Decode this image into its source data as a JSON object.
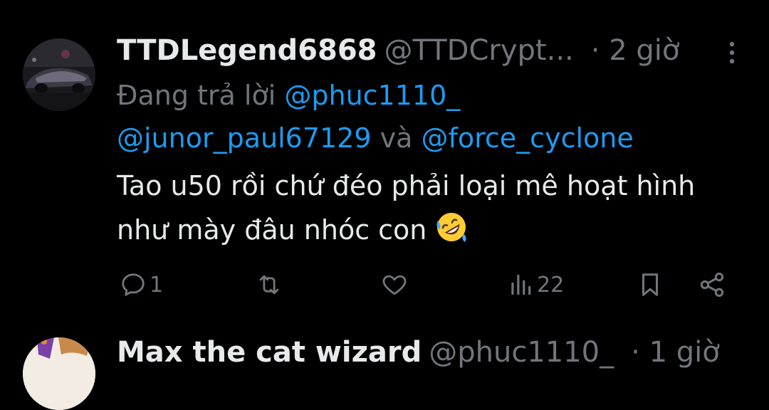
{
  "tweet": {
    "display_name": "TTDLegend6868",
    "handle": "@TTDCrypt...",
    "separator": "·",
    "time": "2 giờ",
    "avatar_icon": "profile-photo-car",
    "reply_prefix": "Đang trả lời",
    "reply_mentions": [
      "@phuc1110_",
      "@junor_paul67129",
      "@force_cyclone"
    ],
    "reply_conjunction": "và",
    "text": "Tao u50 rồi chứ đéo phải loại mê hoạt hình như mày đâu nhóc con",
    "emoji_icon": "rolling-on-floor-laughing-emoji",
    "actions": {
      "reply_count": "1",
      "retweet_count": "",
      "like_count": "",
      "views_count": "22"
    }
  },
  "next_tweet": {
    "display_name": "Max the cat wizard",
    "handle": "@phuc1110_",
    "separator": "·",
    "time": "1 giờ",
    "avatar_icon": "anime-avatar"
  },
  "colors": {
    "background": "#000000",
    "primary_text": "#e7e9ea",
    "secondary_text": "#71767b",
    "link": "#1d9bf0"
  }
}
